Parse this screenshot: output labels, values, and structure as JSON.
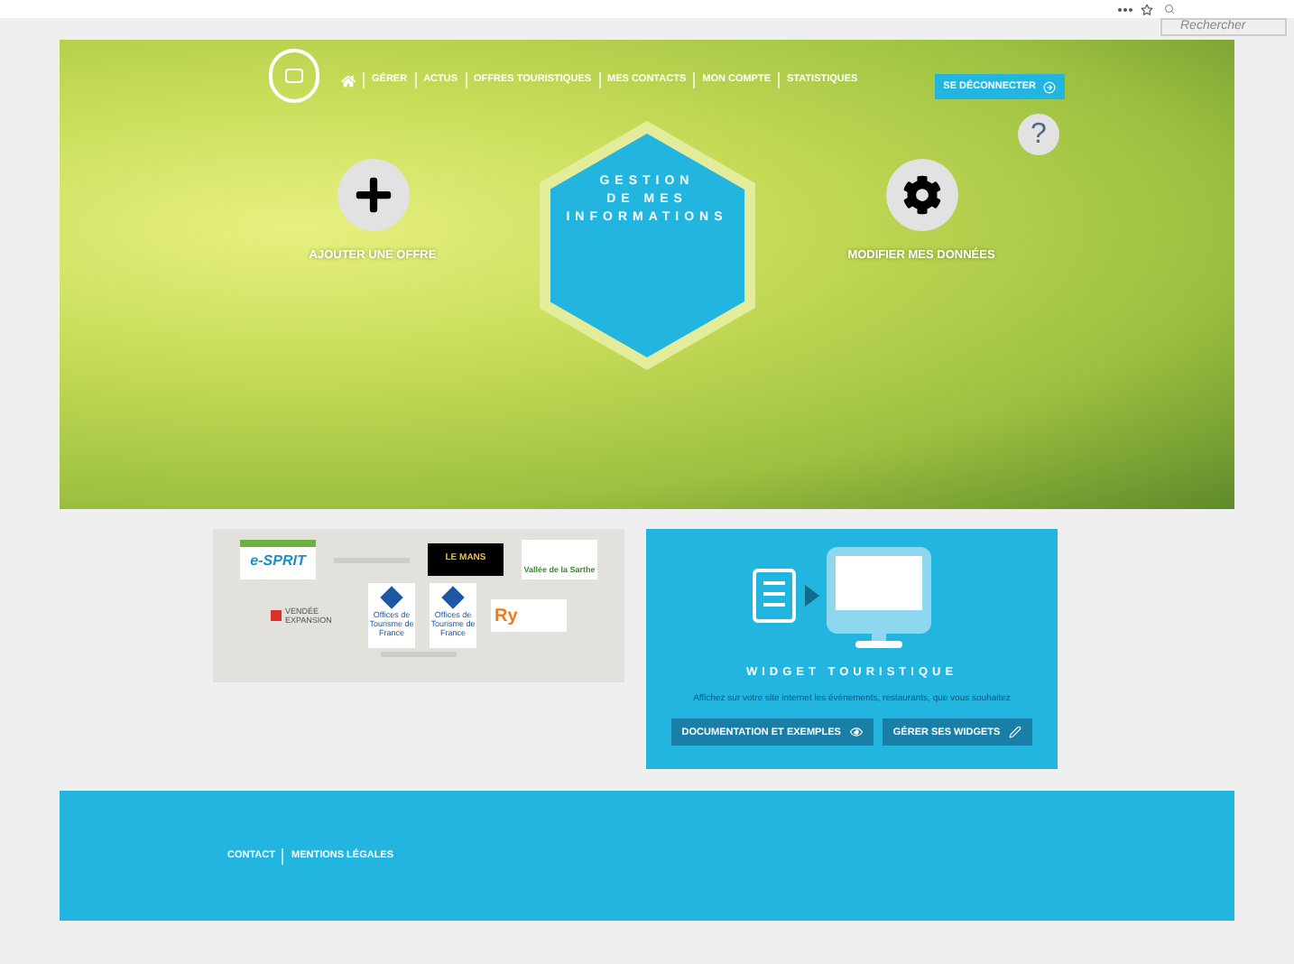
{
  "browser_bar": {
    "search": {
      "placeholder": "Rechercher"
    }
  },
  "nav": {
    "items": [
      {
        "label": "GÉRER"
      },
      {
        "label": "ACTUS"
      },
      {
        "label": "OFFRES TOURISTIQUES"
      },
      {
        "label": "MES CONTACTS"
      },
      {
        "label": "MON COMPTE"
      },
      {
        "label": "STATISTIQUES"
      }
    ],
    "logout": "SE DÉCONNECTER",
    "help": "?"
  },
  "hero": {
    "title_lines": [
      "GESTION",
      "DE MES",
      "INFORMATIONS"
    ],
    "actions": [
      {
        "kind": "add",
        "label": "AJOUTER UNE OFFRE"
      },
      {
        "kind": "settings",
        "label": "MODIFIER MES DONNÉES"
      }
    ]
  },
  "partners": [
    {
      "kind": "esprit",
      "label": "e-SPRIT"
    },
    {
      "kind": "broken"
    },
    {
      "kind": "lemans",
      "label": "LE MANS"
    },
    {
      "kind": "sarthe",
      "label": "Vallée de la Sarthe"
    },
    {
      "kind": "vendee",
      "label": "VENDÉE EXPANSION"
    },
    {
      "kind": "otf",
      "label": "Offices de Tourisme de France"
    },
    {
      "kind": "otf",
      "label": "Offices de Tourisme de France"
    },
    {
      "kind": "ry",
      "label": "Ry"
    },
    {
      "kind": "broken"
    }
  ],
  "widget": {
    "title": "WIDGET TOURISTIQUE",
    "description": "Affichez sur votre site internet les événements, restaurants, que vous souhaitez",
    "buttons": [
      {
        "kind": "docs",
        "label": "DOCUMENTATION ET EXEMPLES"
      },
      {
        "kind": "manage",
        "label": "GÉRER SES WIDGETS"
      }
    ]
  },
  "footer": {
    "links": [
      "CONTACT",
      "MENTIONS LÉGALES"
    ]
  }
}
